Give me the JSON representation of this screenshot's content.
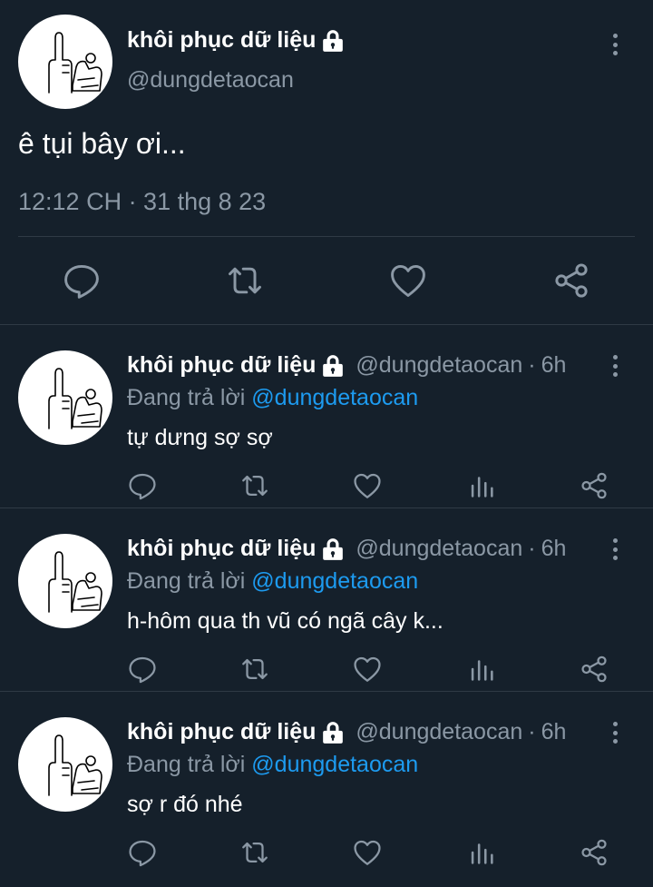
{
  "main_tweet": {
    "name": "khôi phục dữ liệu",
    "handle": "@dungdetaocan",
    "text": "ê tụi bây ơi...",
    "timestamp": "12:12 CH · 31 thg 8 23"
  },
  "replies": [
    {
      "name": "khôi phục dữ liệu",
      "handle": "@dungdetaocan",
      "sep": "·",
      "time": "6h",
      "replying_prefix": "Đang trả lời",
      "replying_to": "@dungdetaocan",
      "text": "tự dưng sợ sợ"
    },
    {
      "name": "khôi phục dữ liệu",
      "handle": "@dungdetaocan",
      "sep": "·",
      "time": "6h",
      "replying_prefix": "Đang trả lời",
      "replying_to": "@dungdetaocan",
      "text": "h-hôm qua th vũ có ngã cây k..."
    },
    {
      "name": "khôi phục dữ liệu",
      "handle": "@dungdetaocan",
      "sep": "·",
      "time": "6h",
      "replying_prefix": "Đang trả lời",
      "replying_to": "@dungdetaocan",
      "text": "sợ r đó nhé"
    }
  ],
  "icons": {
    "reply": "reply-icon",
    "retweet": "retweet-icon",
    "like": "like-icon",
    "views": "views-icon",
    "share": "share-icon",
    "lock": "lock-icon",
    "more": "more-options-icon"
  },
  "colors": {
    "background": "#15202b",
    "text_primary": "#ffffff",
    "text_secondary": "#8b98a5",
    "link": "#1d9bf0",
    "divider": "#2f3a45"
  }
}
